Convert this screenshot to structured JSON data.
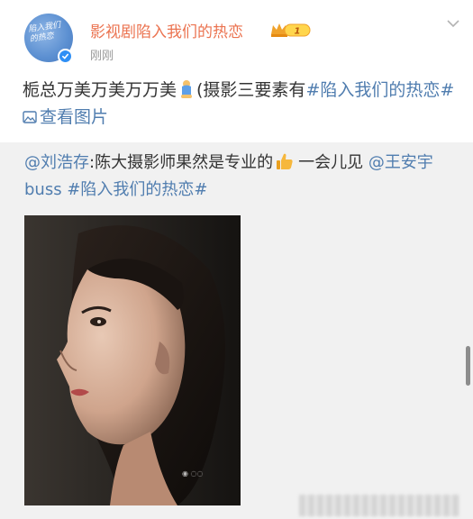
{
  "post": {
    "author_name": "影视剧陷入我们的热恋",
    "vip_level": "1",
    "time": "刚刚",
    "text_part1": "栀总万美万美万万美",
    "text_part2": "(摄影三要素有",
    "topic1": "#陷入我们的热恋#",
    "view_images": "查看图片",
    "avatar_text": "陷入我们的热恋"
  },
  "repost": {
    "mention1": "@刘浩存",
    "text_part1": ":陈大摄影师果然是专业的",
    "text_part2": "一会儿见",
    "mention2": "@王安宇buss",
    "topic": "#陷入我们的热恋#"
  },
  "icons": {
    "avatar": "avatar-icon",
    "verified": "verified-check-icon",
    "vip": "crown-vip-icon",
    "chevron": "chevron-down-icon",
    "emoji_figure": "emoji-figure-icon",
    "picture": "picture-icon",
    "thumbs_up": "thumbs-up-icon"
  },
  "colors": {
    "author": "#eb7350",
    "link": "#507daf",
    "text": "#333333",
    "muted": "#999999",
    "verified": "#2f8ff5"
  }
}
